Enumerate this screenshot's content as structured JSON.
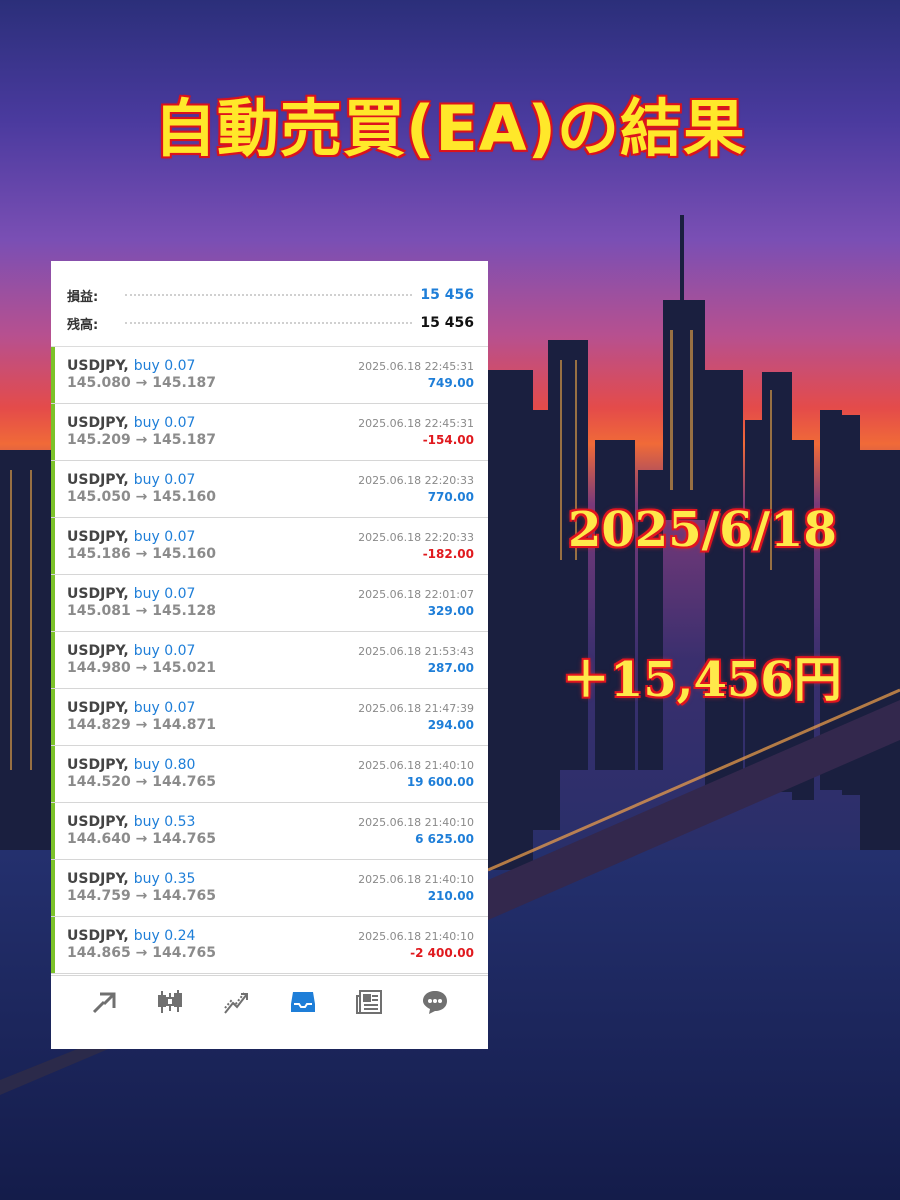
{
  "headline": "自動売買(EA)の結果",
  "date_label": "2025/6/18",
  "profit_label": "＋15,456円",
  "summary": {
    "profit_label": "損益:",
    "profit_value": "15 456",
    "balance_label": "残高:",
    "balance_value": "15 456"
  },
  "trades": [
    {
      "symbol": "USDJPY,",
      "side": "buy 0.07",
      "time": "2025.06.18 22:45:31",
      "prices": "145.080 → 145.187",
      "pl": "749.00",
      "pl_sign": "pos"
    },
    {
      "symbol": "USDJPY,",
      "side": "buy 0.07",
      "time": "2025.06.18 22:45:31",
      "prices": "145.209 → 145.187",
      "pl": "-154.00",
      "pl_sign": "neg"
    },
    {
      "symbol": "USDJPY,",
      "side": "buy 0.07",
      "time": "2025.06.18 22:20:33",
      "prices": "145.050 → 145.160",
      "pl": "770.00",
      "pl_sign": "pos"
    },
    {
      "symbol": "USDJPY,",
      "side": "buy 0.07",
      "time": "2025.06.18 22:20:33",
      "prices": "145.186 → 145.160",
      "pl": "-182.00",
      "pl_sign": "neg"
    },
    {
      "symbol": "USDJPY,",
      "side": "buy 0.07",
      "time": "2025.06.18 22:01:07",
      "prices": "145.081 → 145.128",
      "pl": "329.00",
      "pl_sign": "pos"
    },
    {
      "symbol": "USDJPY,",
      "side": "buy 0.07",
      "time": "2025.06.18 21:53:43",
      "prices": "144.980 → 145.021",
      "pl": "287.00",
      "pl_sign": "pos"
    },
    {
      "symbol": "USDJPY,",
      "side": "buy 0.07",
      "time": "2025.06.18 21:47:39",
      "prices": "144.829 → 144.871",
      "pl": "294.00",
      "pl_sign": "pos"
    },
    {
      "symbol": "USDJPY,",
      "side": "buy 0.80",
      "time": "2025.06.18 21:40:10",
      "prices": "144.520 → 144.765",
      "pl": "19 600.00",
      "pl_sign": "pos"
    },
    {
      "symbol": "USDJPY,",
      "side": "buy 0.53",
      "time": "2025.06.18 21:40:10",
      "prices": "144.640 → 144.765",
      "pl": "6 625.00",
      "pl_sign": "pos"
    },
    {
      "symbol": "USDJPY,",
      "side": "buy 0.35",
      "time": "2025.06.18 21:40:10",
      "prices": "144.759 → 144.765",
      "pl": "210.00",
      "pl_sign": "pos"
    },
    {
      "symbol": "USDJPY,",
      "side": "buy 0.24",
      "time": "2025.06.18 21:40:10",
      "prices": "144.865 → 144.765",
      "pl": "-2 400.00",
      "pl_sign": "neg"
    }
  ],
  "toolbar": {
    "icons": [
      "trade-arrows-icon",
      "candlestick-chart-icon",
      "trend-chart-icon",
      "inbox-history-icon",
      "news-icon",
      "chat-bubble-icon"
    ],
    "active_icon": "inbox-history-icon",
    "active_color": "#1e7ed8",
    "inactive_color": "#707070"
  },
  "colors": {
    "positive": "#1e7ed8",
    "negative": "#e0191e",
    "row_accent": "#7cc22a",
    "headline_text": "#ffe82a",
    "headline_outline": "#e0141e"
  }
}
